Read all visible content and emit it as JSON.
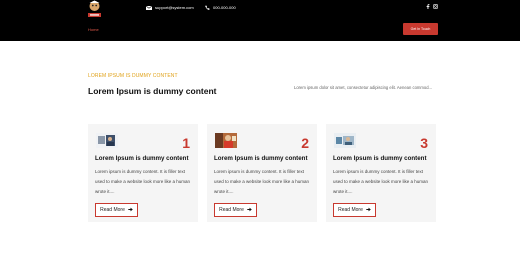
{
  "header": {
    "email": "support@system.com",
    "phone": "000-000-000",
    "nav_home": "Home",
    "cta_label": "Get In Touch"
  },
  "section": {
    "kicker": "LOREM IPSUM IS DUMMY CONTENT",
    "title": "Lorem Ipsum is dummy content",
    "intro": "Lorem ipsum dolor sit amet, consectetur adipiscing elit. Aenean commod..."
  },
  "cards": [
    {
      "number": "1",
      "title": "Lorem Ipsum is dummy content",
      "text": "Lorem ipsum is dummy content. It is filler text used to make a website look more like a human wrote it....",
      "button": "Read More"
    },
    {
      "number": "2",
      "title": "Lorem Ipsum is dummy content",
      "text": "Lorem ipsum is dummy content. It is filler text used to make a website look more like a human wrote it....",
      "button": "Read More"
    },
    {
      "number": "3",
      "title": "Lorem Ipsum is dummy content",
      "text": "Lorem ipsum is dummy content. It is filler text used to make a website look more like a human wrote it....",
      "button": "Read More"
    }
  ],
  "icons": [
    "logo",
    "email-icon",
    "phone-icon",
    "facebook-icon",
    "instagram-icon",
    "arrow-right-icon"
  ],
  "colors": {
    "accent": "#c8392f",
    "kicker": "#e0a21a",
    "header_bg": "#000000",
    "card_bg": "#f5f5f5"
  }
}
